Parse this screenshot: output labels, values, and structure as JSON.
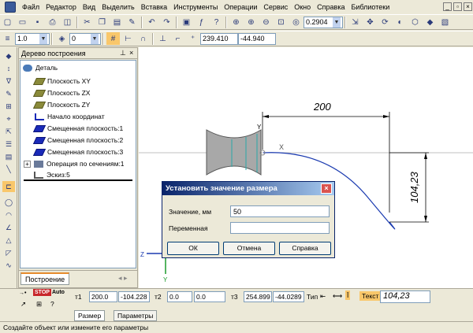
{
  "menu": {
    "items": [
      "Файл",
      "Редактор",
      "Вид",
      "Выделить",
      "Вставка",
      "Инструменты",
      "Операции",
      "Сервис",
      "Окно",
      "Справка",
      "Библиотеки"
    ]
  },
  "toolbar1": {
    "zoom_value": "0.2904",
    "help_hint": "?"
  },
  "toolbar2": {
    "line_scale": "1.0",
    "layer": "0",
    "coord_x": "239.410",
    "coord_y": "-44.940"
  },
  "tree": {
    "title": "Дерево построения",
    "root": "Деталь",
    "items": [
      {
        "label": "Плоскость XY",
        "icon": "plane-icon"
      },
      {
        "label": "Плоскость ZX",
        "icon": "plane-icon"
      },
      {
        "label": "Плоскость ZY",
        "icon": "plane-icon"
      },
      {
        "label": "Начало координат",
        "icon": "origin-icon"
      },
      {
        "label": "Смещенная плоскость:1",
        "icon": "offset-plane-icon"
      },
      {
        "label": "Смещенная плоскость:2",
        "icon": "offset-plane-icon"
      },
      {
        "label": "Смещенная плоскость:3",
        "icon": "offset-plane-icon"
      },
      {
        "label": "Операция по сечениям:1",
        "icon": "loft-icon"
      },
      {
        "label": "Эскиз:5",
        "icon": "sketch-icon"
      }
    ],
    "tab_label": "Построение"
  },
  "canvas": {
    "dim_horizontal": "200",
    "dim_vertical": "104,23",
    "axis_y": "Y",
    "axis_z": "Z",
    "axis_x": "X"
  },
  "dialog": {
    "title": "Установить значение размера",
    "value_label": "Значение, мм",
    "value": "50",
    "variable_label": "Переменная",
    "variable_value": "",
    "ok_label": "ОК",
    "cancel_label": "Отмена",
    "help_label": "Справка"
  },
  "props": {
    "t1_label": "т1",
    "t1_x": "200.0",
    "t1_y": "-104.228",
    "t2_label": "т2",
    "t2_x": "0.0",
    "t2_y": "0.0",
    "t3_label": "т3",
    "t3_x": "254.899",
    "t3_y": "-44.0289",
    "type_label": "Тип",
    "text_label": "Текст",
    "text_value": "104,23",
    "tab_size": "Размер",
    "tab_params": "Параметры",
    "stop_label": "STOP",
    "auto_label": "Auto"
  },
  "status": {
    "message": "Создайте объект или измените его параметры"
  },
  "colors": {
    "accent_title": "#0a246a",
    "curve": "#1a3ab0",
    "grid_line": "#c0c0c0"
  }
}
